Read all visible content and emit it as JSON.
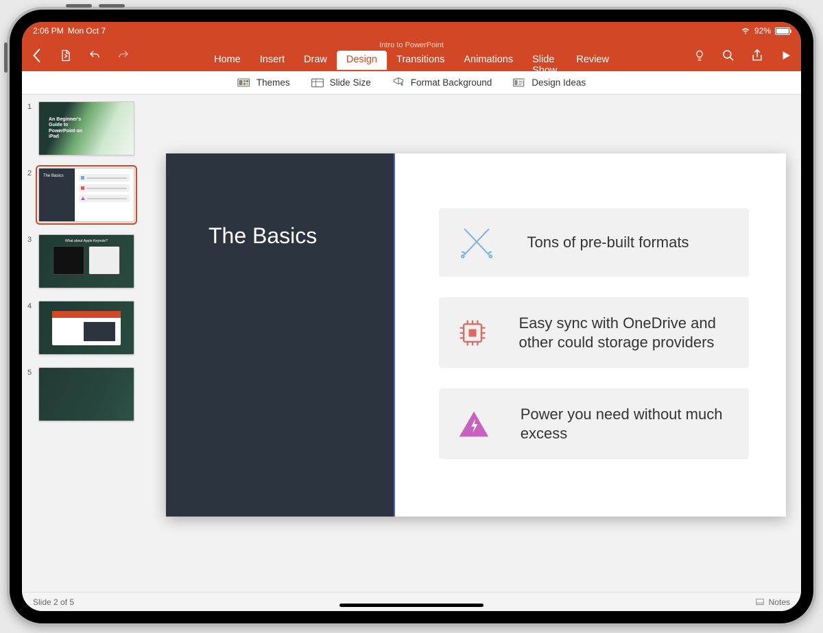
{
  "status": {
    "time": "2:06 PM",
    "date": "Mon Oct 7",
    "battery_pct": "92%"
  },
  "doc_title": "Intro to PowerPoint",
  "tabs": {
    "home": "Home",
    "insert": "Insert",
    "draw": "Draw",
    "design": "Design",
    "transitions": "Transitions",
    "animations": "Animations",
    "slideshow": "Slide Show",
    "review": "Review"
  },
  "ribbon": {
    "themes": "Themes",
    "slide_size": "Slide Size",
    "format_bg": "Format Background",
    "design_ideas": "Design Ideas"
  },
  "thumbs": {
    "n1": "1",
    "n2": "2",
    "n3": "3",
    "n4": "4",
    "n5": "5",
    "t1_line1": "An Beginner's",
    "t1_line2": "Guide to",
    "t1_line3": "PowerPoint on",
    "t1_line4": "iPad",
    "t2_title": "The Basics",
    "t3_title": "What about Apple Keynote?"
  },
  "slide": {
    "title": "The Basics",
    "feat1": "Tons of pre-built formats",
    "feat2": "Easy sync with OneDrive and other could storage providers",
    "feat3": "Power you need without much excess"
  },
  "footer": {
    "left": "Slide 2 of 5",
    "right": "Notes"
  }
}
